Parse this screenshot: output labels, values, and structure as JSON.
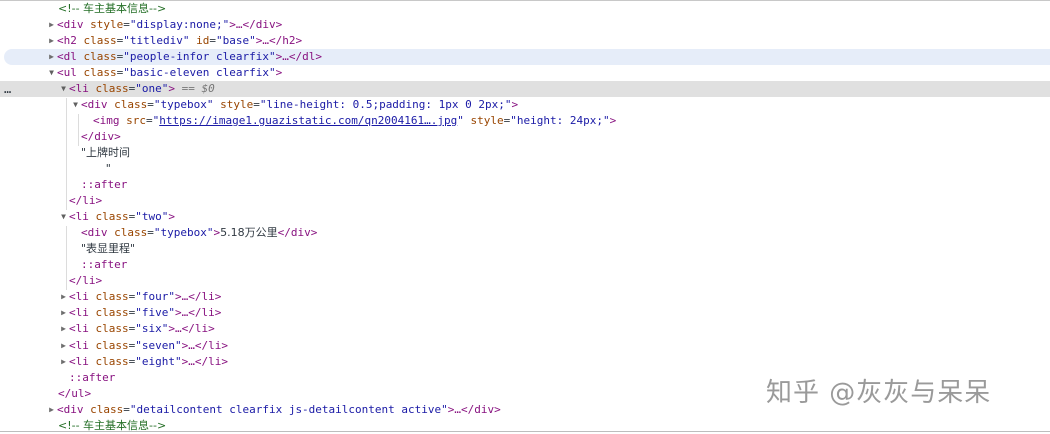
{
  "rows": {
    "r1": {
      "comment": "<!--    车主基本信息-->"
    },
    "r2": {
      "tag_open": "<div",
      "attr": "style",
      "val": "\"display:none;\"",
      "close": ">…</div>"
    },
    "r3": {
      "tag_open": "<h2",
      "a1": "class",
      "v1": "\"titlediv\"",
      "a2": "id",
      "v2": "\"base\"",
      "close": ">…</h2>"
    },
    "r4": {
      "tag_open": "<dl",
      "attr": "class",
      "val": "\"people-infor clearfix\"",
      "close": ">…</dl>"
    },
    "r5": {
      "tag_open": "<ul",
      "attr": "class",
      "val": "\"basic-eleven clearfix\"",
      "close": ">"
    },
    "r6": {
      "tag_open": "<li",
      "attr": "class",
      "val": "\"one\"",
      "close": ">",
      "selected_marker": "== $0"
    },
    "r7": {
      "tag_open": "<div",
      "a1": "class",
      "v1": "\"typebox\"",
      "a2": "style",
      "v2": "\"line-height: 0.5;padding: 1px 0 2px;\"",
      "close": ">"
    },
    "r8": {
      "tag_open": "<img",
      "a1": "src",
      "v1_q1": "\"",
      "link": "https://image1.guazistatic.com/qn2004161….jpg",
      "v1_q2": "\"",
      "a2": "style",
      "v2": "\"height: 24px;\"",
      "close": ">"
    },
    "r9": {
      "close": "</div>"
    },
    "r10": {
      "text": "\"上牌时间"
    },
    "r11": {
      "text": "\""
    },
    "r12": {
      "pseudo": "::after"
    },
    "r13": {
      "close": "</li>"
    },
    "r14": {
      "tag_open": "<li",
      "attr": "class",
      "val": "\"two\"",
      "close": ">"
    },
    "r15": {
      "tag_open": "<div",
      "attr": "class",
      "val": "\"typebox\"",
      "gt": ">",
      "text": "5.18万公里",
      "close": "</div>"
    },
    "r16": {
      "text": "\"表显里程\""
    },
    "r17": {
      "pseudo": "::after"
    },
    "r18": {
      "close": "</li>"
    },
    "r19": {
      "tag_open": "<li",
      "attr": "class",
      "val": "\"four\"",
      "close": ">…</li>"
    },
    "r20": {
      "tag_open": "<li",
      "attr": "class",
      "val": "\"five\"",
      "close": ">…</li>"
    },
    "r21": {
      "tag_open": "<li",
      "attr": "class",
      "val": "\"six\"",
      "close": ">…</li>"
    },
    "r22": {
      "tag_open": "<li",
      "attr": "class",
      "val": "\"seven\"",
      "close": ">…</li>"
    },
    "r23": {
      "tag_open": "<li",
      "attr": "class",
      "val": "\"eight\"",
      "close": ">…</li>"
    },
    "r24": {
      "pseudo": "::after"
    },
    "r25": {
      "close": "</ul>"
    },
    "r26": {
      "tag_open": "<div",
      "attr": "class",
      "val": "\"detailcontent clearfix js-detailcontent active\"",
      "close": ">…</div>"
    },
    "r27": {
      "comment": "<!--    车主基本信息-->"
    }
  },
  "gutter": {
    "ellipsis": "…"
  },
  "watermark": {
    "text": "知乎 @灰灰与呆呆"
  },
  "icons": {
    "expanded": "triangle-down-icon",
    "collapsed": "triangle-right-icon"
  },
  "colors": {
    "tag": "#881280",
    "attr_name": "#994500",
    "attr_value": "#1a1aa6",
    "comment": "#236e25",
    "hover_row": "#e6edf9",
    "selected_row": "#e0e0e0"
  }
}
